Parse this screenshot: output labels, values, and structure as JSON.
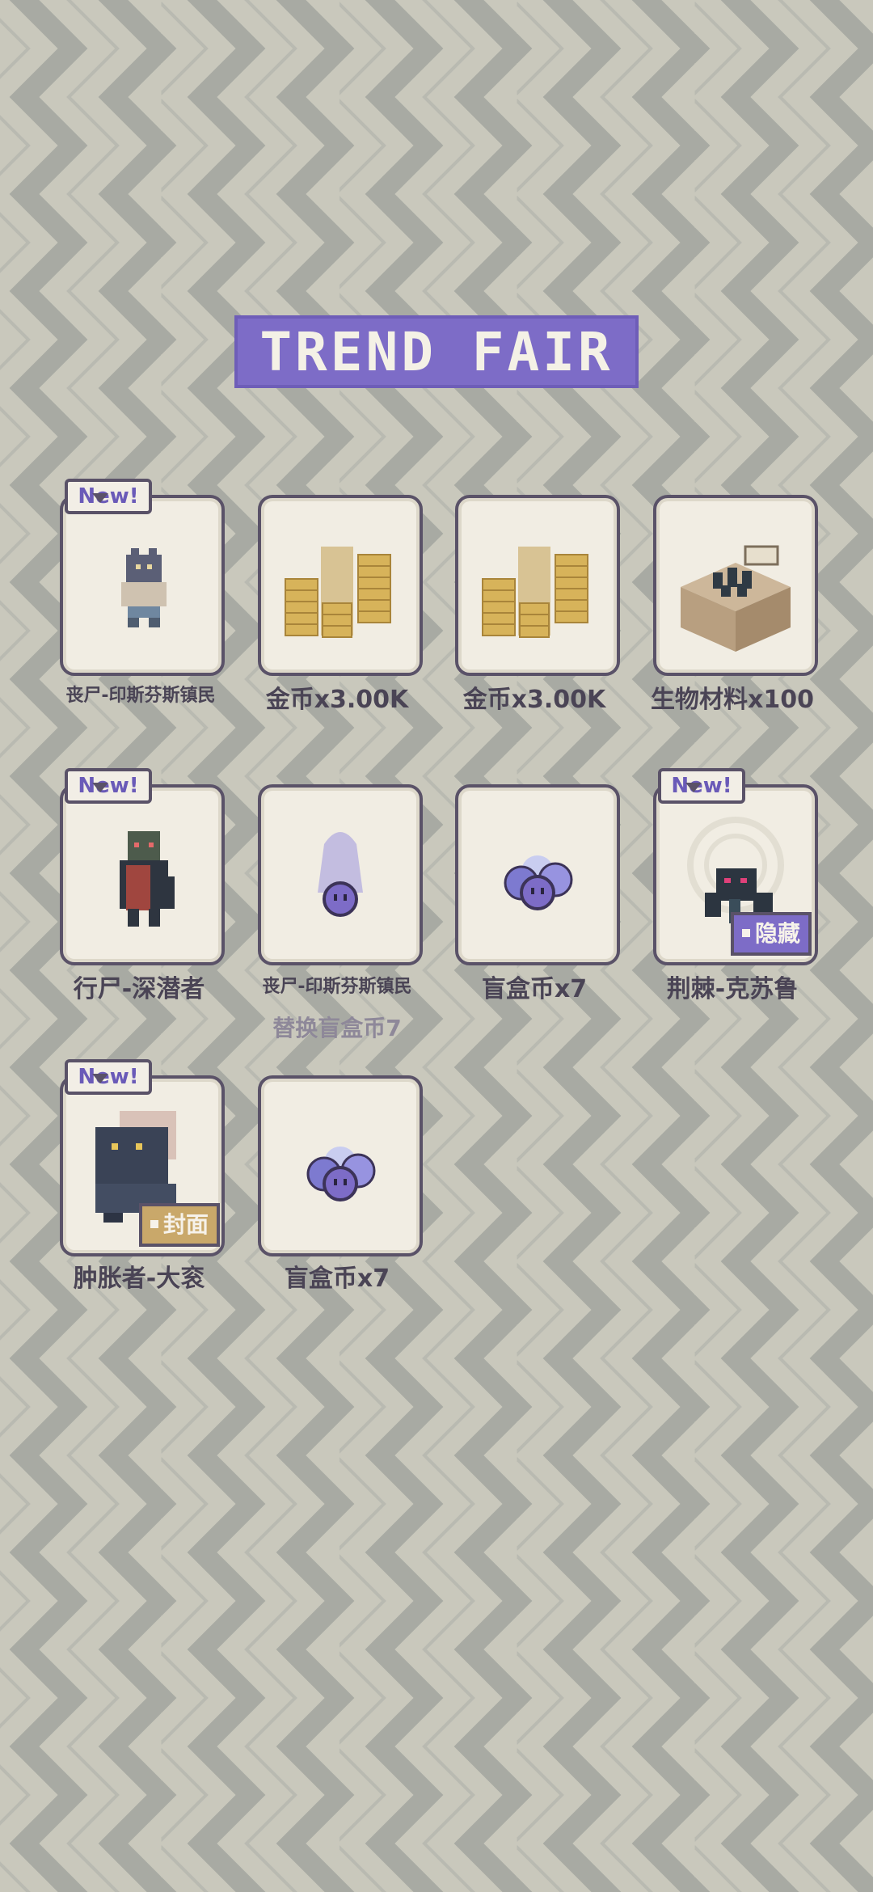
{
  "header": {
    "title": "TREND FAIR"
  },
  "colors": {
    "accent": "#7d6cc7",
    "background": "#c9c8bc",
    "stripe": "#a8aaa3",
    "card": "#f1ede3",
    "frame": "#5a5268",
    "gold": "#c9a86a"
  },
  "badges": {
    "new": "New!"
  },
  "rewards": [
    {
      "label": "丧尸-印斯芬斯镇民",
      "icon": "zombie-villager-icon",
      "new": true
    },
    {
      "label": "金币x3.00K",
      "icon": "gold-coins-icon"
    },
    {
      "label": "金币x3.00K",
      "icon": "gold-coins-icon"
    },
    {
      "label": "生物材料x100",
      "icon": "bio-material-crate-icon"
    },
    {
      "label": "行尸-深潜者",
      "icon": "deep-diver-icon",
      "new": true
    },
    {
      "label": "丧尸-印斯芬斯镇民",
      "sub": "替换盲盒币7",
      "icon": "ghost-blindbox-icon"
    },
    {
      "label": "盲盒币x7",
      "icon": "blindbox-coins-icon"
    },
    {
      "label": "荆棘-克苏鲁",
      "tag": "隐藏",
      "icon": "thorn-cthulhu-icon",
      "new": true
    },
    {
      "label": "肿胀者-大衮",
      "tag": "封面",
      "icon": "bloated-dagon-icon",
      "new": true
    },
    {
      "label": "盲盒币x7",
      "icon": "blindbox-coins-icon"
    }
  ]
}
